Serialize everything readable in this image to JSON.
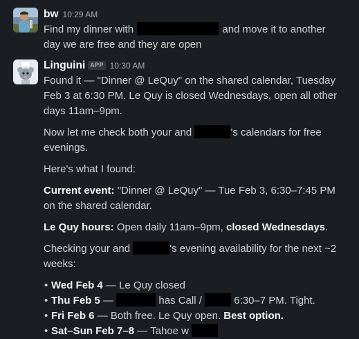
{
  "messages": [
    {
      "sender": "bw",
      "time": "10:29 AM",
      "text_a": "Find my dinner with",
      "text_b": "and move it to another",
      "text_c": "day we are free and they are open"
    },
    {
      "sender": "Linguini",
      "badge": "APP",
      "time": "10:30 AM",
      "p1_l1": "Found it — \"Dinner @ LeQuy\" on the shared calendar, Tuesday",
      "p1_l2": "Feb 3 at 6:30 PM. Le Quy is closed Wednesdays, open all other",
      "p1_l3": "days 11am–9pm.",
      "p2_a": "Now let me check both your and",
      "p2_b": "'s calendars for free",
      "p2_c": "evenings.",
      "p3": "Here's what I found:",
      "p4_label": "Current event:",
      "p4_a": "\"Dinner @ LeQuy\" — Tue Feb 3, 6:30–7:45 PM",
      "p4_b": "on the shared calendar.",
      "p5_label": "Le Quy hours:",
      "p5_a": "Open daily 11am–9pm,",
      "p5_bold": "closed Wednesdays",
      "p5_end": ".",
      "p6_a": "Checking your and",
      "p6_b": "'s evening availability for the next ~2",
      "p6_c": "weeks:",
      "bullets": [
        {
          "bold": "Wed Feb 4",
          "text": " — Le Quy closed"
        },
        {
          "bold": "Thu Feb 5",
          "text_a": " — ",
          "text_b": " has Call / ",
          "text_c": " 6:30–7 PM. Tight."
        },
        {
          "bold": "Fri Feb 6",
          "text_a": " — Both free. Le Quy open. ",
          "bold2": "Best option."
        },
        {
          "bold": "Sat–Sun Feb 7–8",
          "text": " — Tahoe w "
        }
      ],
      "bullet_char": "•"
    }
  ],
  "colors": {
    "background": "#1a1d21",
    "text": "#d1d2d3",
    "timestamp": "#ababad",
    "redaction": "#000000"
  }
}
